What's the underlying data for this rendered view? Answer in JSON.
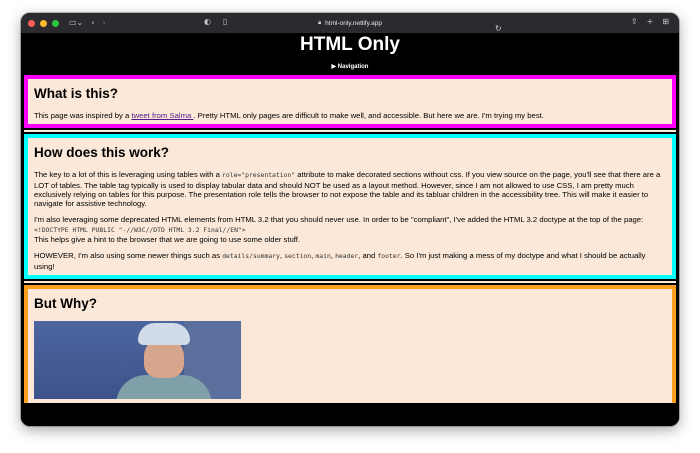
{
  "browser": {
    "url": "html-only.netlify.app",
    "icons": [
      "sidebar-icon",
      "back-icon",
      "forward-icon",
      "shield-icon",
      "reader-icon",
      "lock-icon",
      "reload-icon",
      "share-icon",
      "new-tab-icon",
      "tabs-overview-icon"
    ]
  },
  "header": {
    "title": "HTML Only",
    "nav_label": "▶ Navigation"
  },
  "section1": {
    "heading": "What is this?",
    "text_before": "This page was inspired by a ",
    "link": "tweet from Salma ",
    "text_after": ". Pretty HTML only pages are difficult to make well, and accessible. But here we are. I'm trying my best."
  },
  "section2": {
    "heading": "How does this work?",
    "p1_a": "The key to a lot of this is leveraging using tables with a ",
    "p1_code": "role=\"presentation\"",
    "p1_b": " attribute to make decorated sections without css. If you view source on the page, you'll see that there are a LOT of tables. The table tag typically is used to display tabular data and should NOT be used as a layout method. However, since I am not allowed to use CSS, I am pretty much exclusively relying on tables for this purpose. The presentation role tells the browser to not expose the table and its tabluar children in the accessibility tree. This will make it easier to navigate for assistive technology.",
    "p2_a": "I'm also leveraging some deprecated HTML elements from HTML 3.2 that you should never use. In order to be \"compliant\", I've added the HTML 3.2 doctype at the top of the page:",
    "p2_code": "<!DOCTYPE HTML PUBLIC \"-//W3C//DTD HTML 3.2 Final//EN\">",
    "p2_b": "This helps give a hint to the browser that we are going to use some older stuff.",
    "p3_a": "HOWEVER, I'm also using some newer things such as ",
    "p3_c1": "details/summary",
    "p3_s1": ", ",
    "p3_c2": "section",
    "p3_s2": ", ",
    "p3_c3": "main",
    "p3_s3": ", ",
    "p3_c4": "header",
    "p3_s4": ", and ",
    "p3_c5": "footer",
    "p3_b": ". So I'm just making a mess of my doctype and what I should be actually using!"
  },
  "section3": {
    "heading": "But Why?"
  },
  "colors": {
    "section1_border": "#ff00ff",
    "section2_border": "#00ffff",
    "section3_border": "#ff9d1f",
    "section_bg": "#fbe8d8",
    "link": "#551a8b"
  }
}
